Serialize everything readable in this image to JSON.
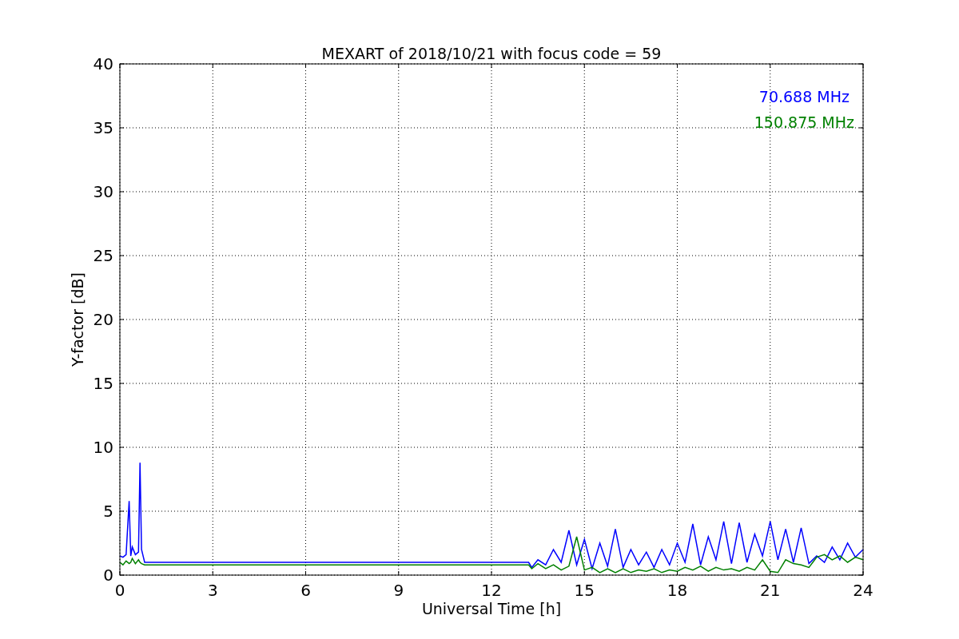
{
  "chart_data": {
    "type": "line",
    "title": "MEXART of 2018/10/21 with focus code = 59",
    "xlabel": "Universal Time [h]",
    "ylabel": "Y-factor [dB]",
    "x": [
      0,
      0.1,
      0.2,
      0.3,
      0.35,
      0.4,
      0.5,
      0.6,
      0.65,
      0.7,
      0.8,
      1,
      2,
      3,
      4,
      5,
      6,
      7,
      8,
      9,
      10,
      11,
      12,
      13,
      13.2,
      13.3,
      13.5,
      13.75,
      14,
      14.25,
      14.5,
      14.75,
      15,
      15.25,
      15.5,
      15.75,
      16,
      16.25,
      16.5,
      16.75,
      17,
      17.25,
      17.5,
      17.75,
      18,
      18.25,
      18.5,
      18.75,
      19,
      19.25,
      19.5,
      19.75,
      20,
      20.25,
      20.5,
      20.75,
      21,
      21.25,
      21.5,
      21.75,
      22,
      22.25,
      22.5,
      22.75,
      23,
      23.25,
      23.5,
      23.75,
      24
    ],
    "series": [
      {
        "name": "70.688 MHz",
        "color": "#0000ff",
        "values": [
          1.5,
          1.4,
          1.6,
          5.8,
          1.5,
          2.2,
          1.6,
          1.8,
          8.8,
          2.0,
          1.0,
          1.0,
          1.0,
          1.0,
          1.0,
          1.0,
          1.0,
          1.0,
          1.0,
          1.0,
          1.0,
          1.0,
          1.0,
          1.0,
          1.0,
          0.6,
          1.2,
          0.8,
          2.0,
          1.0,
          3.5,
          0.8,
          2.8,
          0.5,
          2.5,
          0.7,
          3.6,
          0.6,
          2.0,
          0.8,
          1.8,
          0.6,
          2.0,
          0.8,
          2.5,
          1.0,
          4.0,
          0.8,
          3.0,
          1.2,
          4.2,
          0.9,
          4.1,
          1.0,
          3.2,
          1.5,
          4.2,
          1.2,
          3.6,
          1.0,
          3.7,
          0.9,
          1.5,
          1.0,
          2.2,
          1.2,
          2.5,
          1.4,
          2.0
        ]
      },
      {
        "name": "150.875 MHz",
        "color": "#008000",
        "values": [
          1.0,
          0.8,
          1.1,
          0.9,
          1.0,
          1.3,
          0.9,
          1.2,
          1.0,
          0.9,
          0.8,
          0.8,
          0.8,
          0.8,
          0.8,
          0.8,
          0.8,
          0.8,
          0.8,
          0.8,
          0.8,
          0.8,
          0.8,
          0.8,
          0.8,
          0.5,
          0.9,
          0.5,
          0.8,
          0.4,
          0.7,
          3.0,
          0.4,
          0.6,
          0.2,
          0.5,
          0.2,
          0.5,
          0.2,
          0.4,
          0.3,
          0.5,
          0.2,
          0.4,
          0.3,
          0.6,
          0.4,
          0.7,
          0.3,
          0.6,
          0.4,
          0.5,
          0.3,
          0.6,
          0.4,
          1.2,
          0.3,
          0.2,
          1.2,
          0.9,
          0.8,
          0.6,
          1.4,
          1.6,
          1.2,
          1.5,
          1.0,
          1.4,
          1.2
        ]
      }
    ],
    "xlim": [
      0,
      24
    ],
    "ylim": [
      0,
      40
    ],
    "grid": true,
    "xticks": [
      0,
      3,
      6,
      9,
      12,
      15,
      18,
      21,
      24
    ],
    "yticks": [
      0,
      5,
      10,
      15,
      20,
      25,
      30,
      35,
      40
    ]
  }
}
